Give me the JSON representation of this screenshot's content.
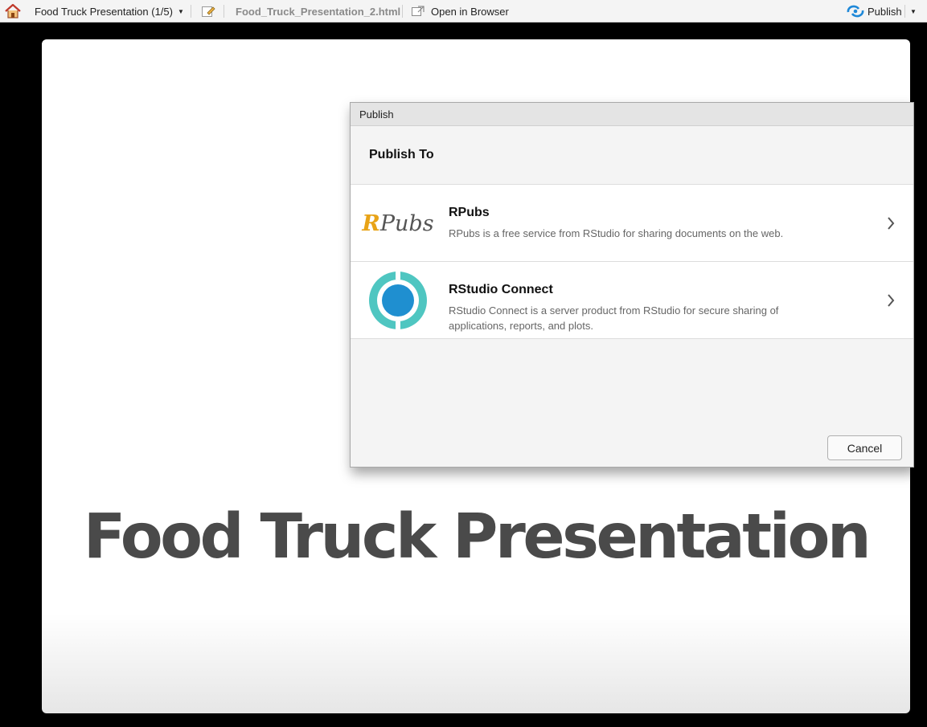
{
  "toolbar": {
    "presentation_title": "Food Truck Presentation (1/5)",
    "file_name": "Food_Truck_Presentation_2.html",
    "open_in_browser": "Open in Browser",
    "publish_label": "Publish"
  },
  "slide": {
    "title": "Food Truck Presentation"
  },
  "dialog": {
    "window_title": "Publish",
    "header": "Publish To",
    "options": [
      {
        "logo_prefix": "R",
        "logo_text": "Pubs",
        "title": "RPubs",
        "description": "RPubs is a free service from RStudio for sharing documents on the web."
      },
      {
        "title": "RStudio Connect",
        "description": "RStudio Connect is a server product from RStudio for secure sharing of applications, reports, and plots."
      }
    ],
    "cancel_label": "Cancel"
  },
  "colors": {
    "rpubs_orange": "#e8a317",
    "connect_teal": "#4fc6c1",
    "connect_blue": "#1f8fd0",
    "publish_blue": "#1e88d8"
  }
}
